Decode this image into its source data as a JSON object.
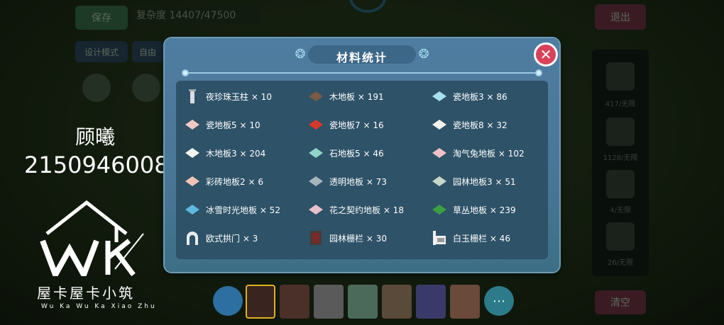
{
  "background": {
    "save_label": "保存",
    "complexity": "复杂度 14407/47500",
    "design_label": "设计模式",
    "free_label": "自由",
    "exit_label": "退出",
    "clear_label": "清空",
    "right_panel": [
      "417/无限",
      "1128/无限",
      "4/无限",
      "26/无限"
    ]
  },
  "watermark": {
    "name": "顾曦",
    "number": "2150946008",
    "logo_title": "屋卡屋卡小筑",
    "logo_sub": "Wu Ka Wu Ka Xiao Zhu"
  },
  "dialog": {
    "title": "材料统计",
    "close_icon": "close-icon",
    "colors": {
      "accent": "#d9435a",
      "panel": "#2e5268",
      "frame": "#4f7da1"
    },
    "items": [
      {
        "label": "夜珍珠玉柱 × 10",
        "icon": "pillar",
        "color": "#d8dde0"
      },
      {
        "label": "木地板 × 191",
        "icon": "tile",
        "color": "#7a5a44"
      },
      {
        "label": "瓷地板3 × 86",
        "icon": "tile",
        "color": "#a9e0ee"
      },
      {
        "label": "瓷地板5 × 10",
        "icon": "tile",
        "color": "#f1c9c4"
      },
      {
        "label": "瓷地板7 × 16",
        "icon": "tile",
        "color": "#d8382c"
      },
      {
        "label": "瓷地板8 × 32",
        "icon": "tile",
        "color": "#f4f2ea"
      },
      {
        "label": "木地板3 × 204",
        "icon": "tile",
        "color": "#f6f4ee"
      },
      {
        "label": "石地板5 × 46",
        "icon": "tile",
        "color": "#8fd6c6"
      },
      {
        "label": "淘气兔地板 × 102",
        "icon": "tile",
        "color": "#f0c0c8"
      },
      {
        "label": "彩砖地板2 × 6",
        "icon": "tile",
        "color": "#f2c4b6"
      },
      {
        "label": "透明地板 × 73",
        "icon": "tile",
        "color": "#a6b4bc"
      },
      {
        "label": "园林地板3 × 51",
        "icon": "tile",
        "color": "#c8d8c8"
      },
      {
        "label": "冰雪时光地板 × 52",
        "icon": "tile",
        "color": "#5fb8e0"
      },
      {
        "label": "花之契约地板 × 18",
        "icon": "tile",
        "color": "#e8c0cc"
      },
      {
        "label": "草丛地板 × 239",
        "icon": "tile",
        "color": "#3aa040"
      },
      {
        "label": "欧式拱门 × 3",
        "icon": "arch",
        "color": "#e8ecef"
      },
      {
        "label": "园林栅栏 × 30",
        "icon": "gate",
        "color": "#4a3a36"
      },
      {
        "label": "白玉栅栏 × 46",
        "icon": "fence",
        "color": "#f0f0f0"
      }
    ]
  }
}
